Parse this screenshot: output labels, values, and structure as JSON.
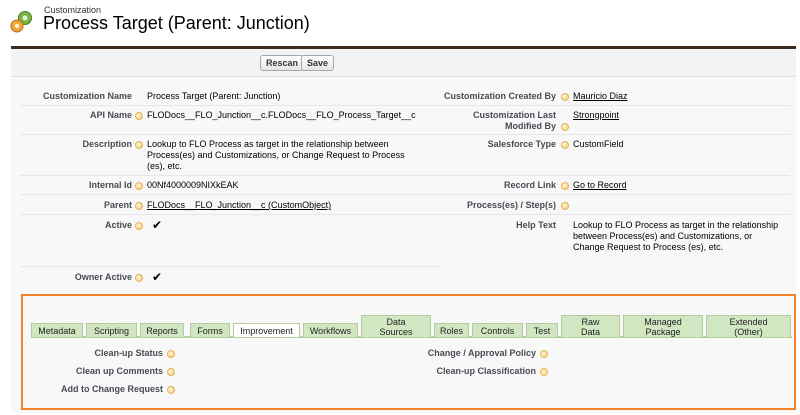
{
  "header": {
    "breadcrumb": "Customization",
    "title": "Process Target (Parent: Junction)"
  },
  "toolbar": {
    "rescan_label": "Rescan",
    "save_label": "Save"
  },
  "fields": {
    "customization_name": {
      "label": "Customization Name",
      "value": "Process Target (Parent: Junction)"
    },
    "api_name": {
      "label": "API Name",
      "value": "FLODocs__FLO_Junction__c.FLODocs__FLO_Process_Target__c"
    },
    "description": {
      "label": "Description",
      "value": "Lookup to FLO Process as target in the relationship between Process(es) and Customizations, or Change Request to Process (es), etc."
    },
    "internal_id": {
      "label": "Internal Id",
      "value": "00Nf4000009NIXkEAK"
    },
    "parent": {
      "label": "Parent",
      "value": "FLODocs__FLO_Junction__c (CustomObject)"
    },
    "active": {
      "label": "Active",
      "value": "✔"
    },
    "owner_active": {
      "label": "Owner Active",
      "value": "✔"
    },
    "created_by": {
      "label": "Customization Created By",
      "value": "Mauricio Diaz"
    },
    "last_modified_by": {
      "label_line1": "Customization Last",
      "label_line2": "Modified By",
      "value": "Strongpoint"
    },
    "salesforce_type": {
      "label": "Salesforce Type",
      "value": "CustomField"
    },
    "record_link": {
      "label": "Record Link",
      "value": "Go to Record"
    },
    "process_step": {
      "label": "Process(es) / Step(s)",
      "value": ""
    },
    "help_text": {
      "label": "Help Text",
      "value": "Lookup to FLO Process as target in the relationship between Process(es) and Customizations, or Change Request to Process (es), etc."
    }
  },
  "tabs": [
    {
      "line1": "Metadata",
      "line2": ""
    },
    {
      "line1": "Scripting",
      "line2": ""
    },
    {
      "line1": "Reports",
      "line2": ""
    },
    {
      "line1": "Forms",
      "line2": ""
    },
    {
      "line1": "Improvement",
      "line2": "",
      "active": true
    },
    {
      "line1": "Workflows",
      "line2": ""
    },
    {
      "line1": "Data",
      "line2": "Sources"
    },
    {
      "line1": "Roles",
      "line2": ""
    },
    {
      "line1": "Controls",
      "line2": ""
    },
    {
      "line1": "Test",
      "line2": ""
    },
    {
      "line1": "Raw",
      "line2": "Data"
    },
    {
      "line1": "Managed",
      "line2": "Package"
    },
    {
      "line1": "Extended",
      "line2": "(Other)"
    }
  ],
  "improvement": {
    "cleanup_status": "Clean-up Status",
    "cleanup_comments": "Clean up Comments",
    "add_to_change_request": "Add to Change Request",
    "change_approval_policy": "Change / Approval Policy",
    "cleanup_classification": "Clean-up Classification"
  },
  "colors": {
    "orange_border": "#f3822a",
    "tab_bg": "#d1e7c1",
    "header_rule": "#3b2a1e"
  }
}
